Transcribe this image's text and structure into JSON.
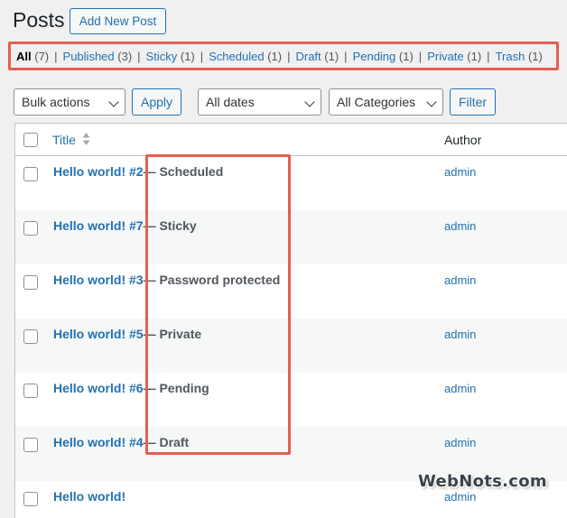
{
  "header": {
    "title": "Posts",
    "add_new_label": "Add New Post"
  },
  "filters": {
    "views": [
      {
        "label": "All",
        "count": "(7)",
        "current": true
      },
      {
        "label": "Published",
        "count": "(3)"
      },
      {
        "label": "Sticky",
        "count": "(1)"
      },
      {
        "label": "Scheduled",
        "count": "(1)"
      },
      {
        "label": "Draft",
        "count": "(1)"
      },
      {
        "label": "Pending",
        "count": "(1)"
      },
      {
        "label": "Private",
        "count": "(1)"
      },
      {
        "label": "Trash",
        "count": "(1)"
      }
    ],
    "separator": "|"
  },
  "toolbar": {
    "bulk_actions": "Bulk actions",
    "apply_label": "Apply",
    "dates": "All dates",
    "categories": "All Categories",
    "filter_label": "Filter"
  },
  "table": {
    "col_title": "Title",
    "col_author": "Author",
    "rows": [
      {
        "title": "Hello world! #2",
        "state": "— Scheduled",
        "author": "admin"
      },
      {
        "title": "Hello world! #7",
        "state": "— Sticky",
        "author": "admin"
      },
      {
        "title": "Hello world! #3",
        "state": "— Password protected",
        "author": "admin"
      },
      {
        "title": "Hello world! #5",
        "state": "— Private",
        "author": "admin"
      },
      {
        "title": "Hello world! #6",
        "state": "— Pending",
        "author": "admin"
      },
      {
        "title": "Hello world! #4",
        "state": "— Draft",
        "author": "admin"
      },
      {
        "title": "Hello world!",
        "state": "",
        "author": "admin"
      }
    ]
  },
  "watermark": "WebNots.com",
  "colors": {
    "link": "#2271b1",
    "highlight": "#e65e50",
    "background": "#f0f0f1"
  }
}
